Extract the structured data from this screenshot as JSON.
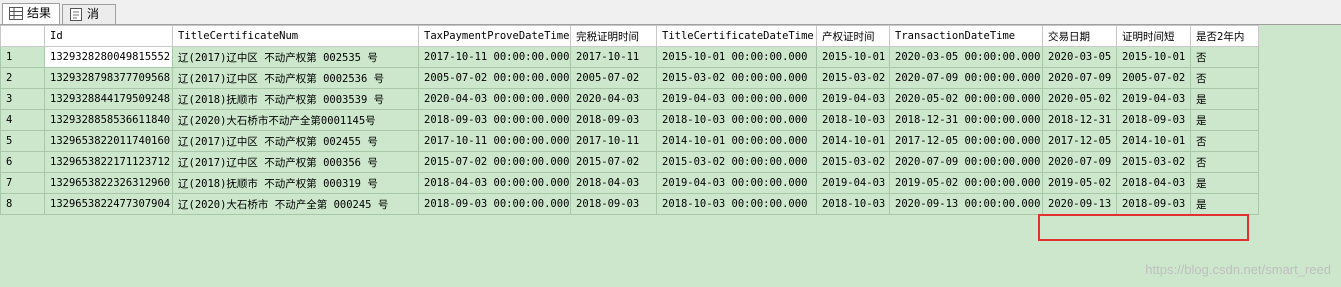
{
  "tabs": [
    {
      "label": "结果",
      "icon": "grid-icon"
    },
    {
      "label": "消息",
      "icon": "message-icon"
    }
  ],
  "grid": {
    "columns": [
      "Id",
      "TitleCertificateNum",
      "TaxPaymentProveDateTime",
      "完税证明时间",
      "TitleCertificateDateTime",
      "产权证时间",
      "TransactionDateTime",
      "交易日期",
      "证明时间短",
      "是否2年内"
    ],
    "rows": [
      {
        "num": "1",
        "cells": [
          "1329328280049815552",
          "辽(2017)辽中区 不动产权第 002535 号",
          "2017-10-11 00:00:00.000",
          "2017-10-11",
          "2015-10-01 00:00:00.000",
          "2015-10-01",
          "2020-03-05 00:00:00.000",
          "2020-03-05",
          "2015-10-01",
          "否"
        ]
      },
      {
        "num": "2",
        "cells": [
          "1329328798377709568",
          "辽(2017)辽中区 不动产权第 0002536 号",
          "2005-07-02 00:00:00.000",
          "2005-07-02",
          "2015-03-02 00:00:00.000",
          "2015-03-02",
          "2020-07-09 00:00:00.000",
          "2020-07-09",
          "2005-07-02",
          "否"
        ]
      },
      {
        "num": "3",
        "cells": [
          "1329328844179509248",
          "辽(2018)抚顺市 不动产权第 0003539 号",
          "2020-04-03 00:00:00.000",
          "2020-04-03",
          "2019-04-03 00:00:00.000",
          "2019-04-03",
          "2020-05-02 00:00:00.000",
          "2020-05-02",
          "2019-04-03",
          "是"
        ]
      },
      {
        "num": "4",
        "cells": [
          "1329328858536611840",
          "辽(2020)大石桥市不动产全第0001145号",
          "2018-09-03 00:00:00.000",
          "2018-09-03",
          "2018-10-03 00:00:00.000",
          "2018-10-03",
          "2018-12-31 00:00:00.000",
          "2018-12-31",
          "2018-09-03",
          "是"
        ]
      },
      {
        "num": "5",
        "cells": [
          "1329653822011740160",
          "辽(2017)辽中区 不动产权第 002455 号",
          "2017-10-11 00:00:00.000",
          "2017-10-11",
          "2014-10-01 00:00:00.000",
          "2014-10-01",
          "2017-12-05 00:00:00.000",
          "2017-12-05",
          "2014-10-01",
          "否"
        ]
      },
      {
        "num": "6",
        "cells": [
          "1329653822171123712",
          "辽(2017)辽中区 不动产权第 000356 号",
          "2015-07-02 00:00:00.000",
          "2015-07-02",
          "2015-03-02 00:00:00.000",
          "2015-03-02",
          "2020-07-09 00:00:00.000",
          "2020-07-09",
          "2015-03-02",
          "否"
        ]
      },
      {
        "num": "7",
        "cells": [
          "1329653822326312960",
          "辽(2018)抚顺市 不动产权第 000319 号",
          "2018-04-03 00:00:00.000",
          "2018-04-03",
          "2019-04-03 00:00:00.000",
          "2019-04-03",
          "2019-05-02 00:00:00.000",
          "2019-05-02",
          "2018-04-03",
          "是"
        ]
      },
      {
        "num": "8",
        "cells": [
          "1329653822477307904",
          "辽(2020)大石桥市 不动产全第 000245 号",
          "2018-09-03 00:00:00.000",
          "2018-09-03",
          "2018-10-03 00:00:00.000",
          "2018-10-03",
          "2020-09-13 00:00:00.000",
          "2020-09-13",
          "2018-09-03",
          "是"
        ]
      }
    ]
  },
  "watermark": "https://blog.csdn.net/smart_reed",
  "colors": {
    "grid_bg": "#cde7cd",
    "highlight": "#e03030"
  }
}
